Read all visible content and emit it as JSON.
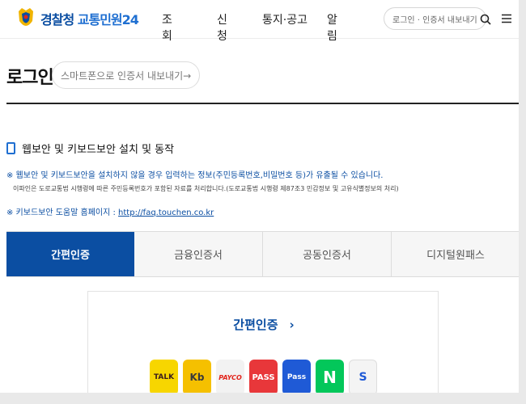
{
  "header": {
    "logo_text_1": "경찰청",
    "logo_text_2": "교통민원24",
    "nav": [
      "조회",
      "신청",
      "통지·공고",
      "알림"
    ],
    "login_export": "로그인 · 인증서 내보내기"
  },
  "page": {
    "title": "로그인",
    "export_button": "스마트폰으로 인증서 내보내기→"
  },
  "notice": {
    "title": "웹보안 및 키보드보안 설치 및 동작",
    "line1": "※ 웹보안 및 키보드보안을 설치하지 않을 경우 입력하는 정보(주민등록번호,비밀번호 등)가 유출될 수 있습니다.",
    "line2": "이파인은 도로교통법 시행령에 따른 주민등록번호가 포함된 자료를 처리합니다.(도로교통법 시행령 제87조3 민감정보 및 고유식별정보의 처리)",
    "line3_prefix": "※ 키보드보안 도움말 홈페이지 : ",
    "line3_link": "http://faq.touchen.co.kr"
  },
  "tabs": [
    "간편인증",
    "금융인증서",
    "공동인증서",
    "디지털원패스"
  ],
  "card": {
    "title": "간편인증",
    "apps": [
      {
        "name": "kakao",
        "label": "TALK"
      },
      {
        "name": "kb",
        "label": "Kb"
      },
      {
        "name": "payco",
        "label": "PAYCO"
      },
      {
        "name": "pass1",
        "label": "PASS"
      },
      {
        "name": "pass2",
        "label": "Pass"
      },
      {
        "name": "naver",
        "label": "N"
      },
      {
        "name": "shinhan",
        "label": "S"
      }
    ]
  },
  "colors": {
    "brand_blue": "#0b4ea2",
    "link_blue": "#1f6fd1"
  },
  "icons": [
    "police-emblem-icon",
    "search-icon",
    "menu-icon",
    "checkbox-icon",
    "chevron-right-icon"
  ]
}
